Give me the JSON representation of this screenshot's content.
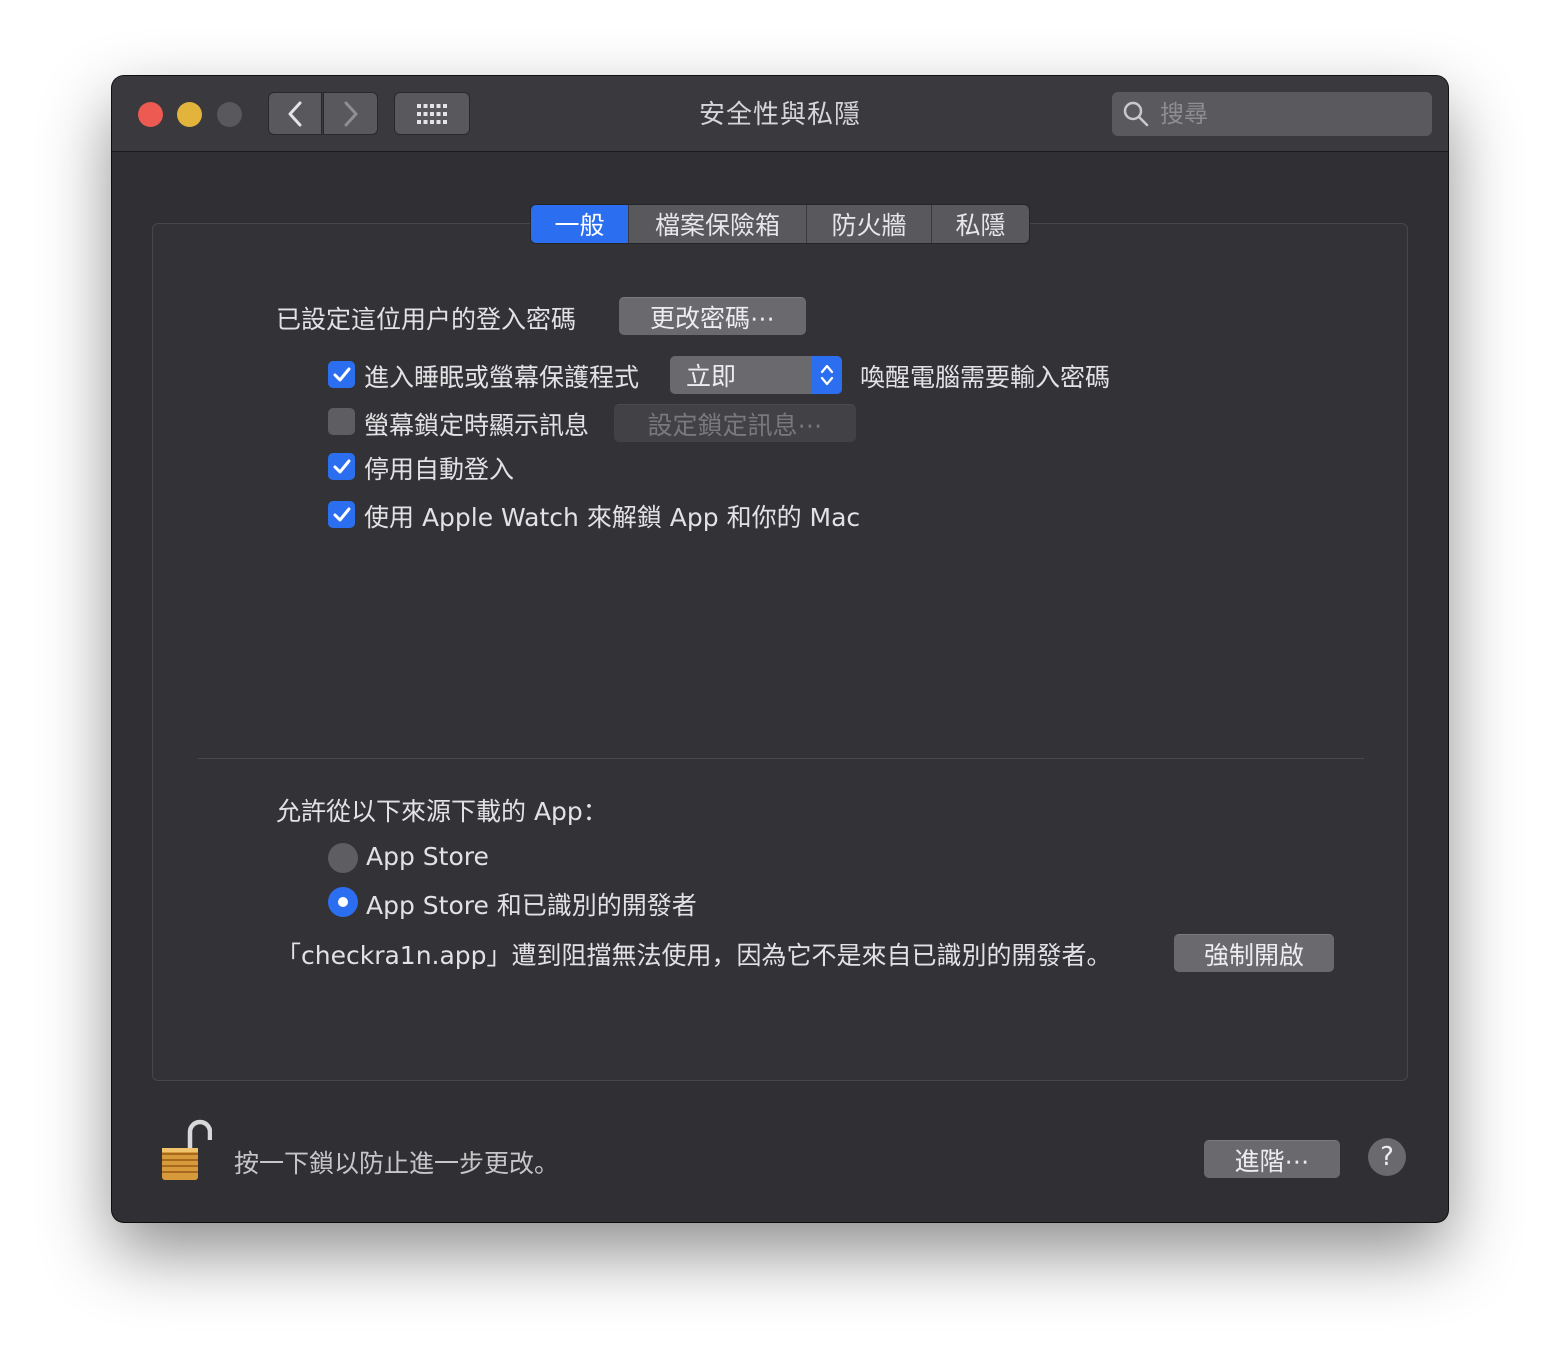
{
  "window": {
    "title": "安全性與私隱"
  },
  "search": {
    "placeholder": "搜尋"
  },
  "tabs": [
    {
      "label": "一般",
      "active": true
    },
    {
      "label": "檔案保險箱",
      "active": false
    },
    {
      "label": "防火牆",
      "active": false
    },
    {
      "label": "私隱",
      "active": false
    }
  ],
  "general": {
    "password_label": "已設定這位用户的登入密碼",
    "change_password_button": "更改密碼⋯",
    "require_password": {
      "checked": true,
      "prefix": "進入睡眠或螢幕保護程式",
      "select_value": "立即",
      "suffix": "喚醒電腦需要輸入密碼"
    },
    "lock_message": {
      "checked": false,
      "label": "螢幕鎖定時顯示訊息",
      "button": "設定鎖定訊息⋯"
    },
    "disable_auto_login": {
      "checked": true,
      "label": "停用自動登入"
    },
    "apple_watch": {
      "checked": true,
      "label": "使用 Apple Watch 來解鎖 App 和你的 Mac"
    }
  },
  "downloads": {
    "heading": "允許從以下來源下載的 App：",
    "options": [
      {
        "label": "App Store",
        "selected": false
      },
      {
        "label": "App Store 和已識別的開發者",
        "selected": true
      }
    ],
    "blocked_message": "「checkra1n.app」遭到阻擋無法使用，因為它不是來自已識別的開發者。",
    "open_anyway_button": "強制開啟"
  },
  "footer": {
    "lock_text": "按一下鎖以防止進一步更改。",
    "advanced_button": "進階⋯",
    "help_label": "?"
  },
  "colors": {
    "accent": "#2b6ff0",
    "window_bg": "#303034",
    "close": "#ec5a52",
    "minimize": "#e3b43c"
  }
}
